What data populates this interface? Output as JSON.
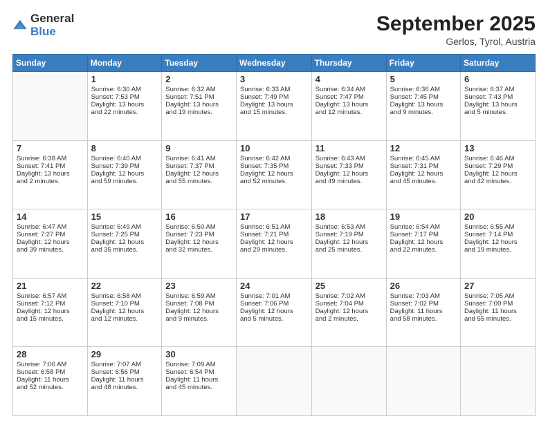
{
  "logo": {
    "general": "General",
    "blue": "Blue"
  },
  "header": {
    "month": "September 2025",
    "location": "Gerlos, Tyrol, Austria"
  },
  "weekdays": [
    "Sunday",
    "Monday",
    "Tuesday",
    "Wednesday",
    "Thursday",
    "Friday",
    "Saturday"
  ],
  "weeks": [
    [
      {
        "day": "",
        "info": ""
      },
      {
        "day": "1",
        "info": "Sunrise: 6:30 AM\nSunset: 7:53 PM\nDaylight: 13 hours\nand 22 minutes."
      },
      {
        "day": "2",
        "info": "Sunrise: 6:32 AM\nSunset: 7:51 PM\nDaylight: 13 hours\nand 19 minutes."
      },
      {
        "day": "3",
        "info": "Sunrise: 6:33 AM\nSunset: 7:49 PM\nDaylight: 13 hours\nand 15 minutes."
      },
      {
        "day": "4",
        "info": "Sunrise: 6:34 AM\nSunset: 7:47 PM\nDaylight: 13 hours\nand 12 minutes."
      },
      {
        "day": "5",
        "info": "Sunrise: 6:36 AM\nSunset: 7:45 PM\nDaylight: 13 hours\nand 9 minutes."
      },
      {
        "day": "6",
        "info": "Sunrise: 6:37 AM\nSunset: 7:43 PM\nDaylight: 13 hours\nand 5 minutes."
      }
    ],
    [
      {
        "day": "7",
        "info": "Sunrise: 6:38 AM\nSunset: 7:41 PM\nDaylight: 13 hours\nand 2 minutes."
      },
      {
        "day": "8",
        "info": "Sunrise: 6:40 AM\nSunset: 7:39 PM\nDaylight: 12 hours\nand 59 minutes."
      },
      {
        "day": "9",
        "info": "Sunrise: 6:41 AM\nSunset: 7:37 PM\nDaylight: 12 hours\nand 55 minutes."
      },
      {
        "day": "10",
        "info": "Sunrise: 6:42 AM\nSunset: 7:35 PM\nDaylight: 12 hours\nand 52 minutes."
      },
      {
        "day": "11",
        "info": "Sunrise: 6:43 AM\nSunset: 7:33 PM\nDaylight: 12 hours\nand 49 minutes."
      },
      {
        "day": "12",
        "info": "Sunrise: 6:45 AM\nSunset: 7:31 PM\nDaylight: 12 hours\nand 45 minutes."
      },
      {
        "day": "13",
        "info": "Sunrise: 6:46 AM\nSunset: 7:29 PM\nDaylight: 12 hours\nand 42 minutes."
      }
    ],
    [
      {
        "day": "14",
        "info": "Sunrise: 6:47 AM\nSunset: 7:27 PM\nDaylight: 12 hours\nand 39 minutes."
      },
      {
        "day": "15",
        "info": "Sunrise: 6:49 AM\nSunset: 7:25 PM\nDaylight: 12 hours\nand 35 minutes."
      },
      {
        "day": "16",
        "info": "Sunrise: 6:50 AM\nSunset: 7:23 PM\nDaylight: 12 hours\nand 32 minutes."
      },
      {
        "day": "17",
        "info": "Sunrise: 6:51 AM\nSunset: 7:21 PM\nDaylight: 12 hours\nand 29 minutes."
      },
      {
        "day": "18",
        "info": "Sunrise: 6:53 AM\nSunset: 7:19 PM\nDaylight: 12 hours\nand 25 minutes."
      },
      {
        "day": "19",
        "info": "Sunrise: 6:54 AM\nSunset: 7:17 PM\nDaylight: 12 hours\nand 22 minutes."
      },
      {
        "day": "20",
        "info": "Sunrise: 6:55 AM\nSunset: 7:14 PM\nDaylight: 12 hours\nand 19 minutes."
      }
    ],
    [
      {
        "day": "21",
        "info": "Sunrise: 6:57 AM\nSunset: 7:12 PM\nDaylight: 12 hours\nand 15 minutes."
      },
      {
        "day": "22",
        "info": "Sunrise: 6:58 AM\nSunset: 7:10 PM\nDaylight: 12 hours\nand 12 minutes."
      },
      {
        "day": "23",
        "info": "Sunrise: 6:59 AM\nSunset: 7:08 PM\nDaylight: 12 hours\nand 9 minutes."
      },
      {
        "day": "24",
        "info": "Sunrise: 7:01 AM\nSunset: 7:06 PM\nDaylight: 12 hours\nand 5 minutes."
      },
      {
        "day": "25",
        "info": "Sunrise: 7:02 AM\nSunset: 7:04 PM\nDaylight: 12 hours\nand 2 minutes."
      },
      {
        "day": "26",
        "info": "Sunrise: 7:03 AM\nSunset: 7:02 PM\nDaylight: 11 hours\nand 58 minutes."
      },
      {
        "day": "27",
        "info": "Sunrise: 7:05 AM\nSunset: 7:00 PM\nDaylight: 11 hours\nand 55 minutes."
      }
    ],
    [
      {
        "day": "28",
        "info": "Sunrise: 7:06 AM\nSunset: 6:58 PM\nDaylight: 11 hours\nand 52 minutes."
      },
      {
        "day": "29",
        "info": "Sunrise: 7:07 AM\nSunset: 6:56 PM\nDaylight: 11 hours\nand 48 minutes."
      },
      {
        "day": "30",
        "info": "Sunrise: 7:09 AM\nSunset: 6:54 PM\nDaylight: 11 hours\nand 45 minutes."
      },
      {
        "day": "",
        "info": ""
      },
      {
        "day": "",
        "info": ""
      },
      {
        "day": "",
        "info": ""
      },
      {
        "day": "",
        "info": ""
      }
    ]
  ]
}
